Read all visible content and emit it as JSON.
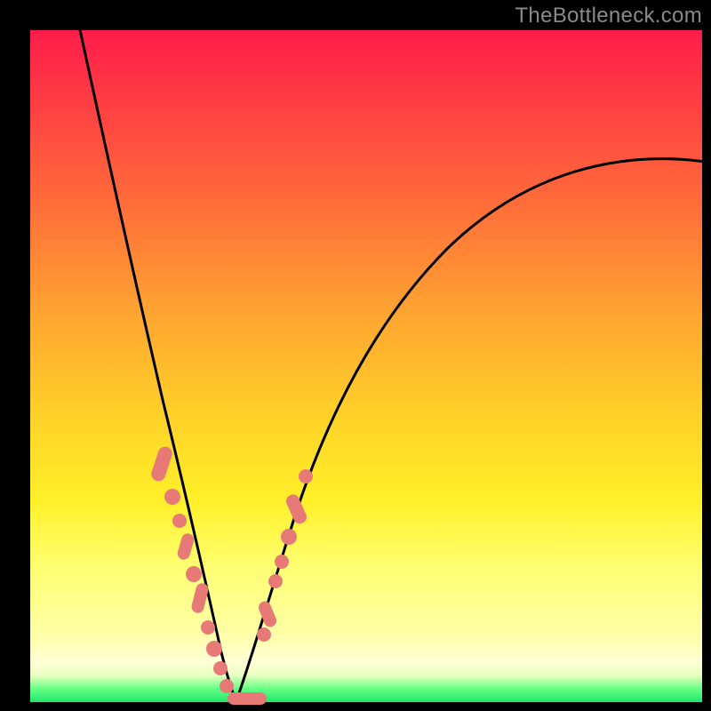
{
  "watermark": "TheBottleneck.com",
  "colors": {
    "gradient_top": "#ff1d4a",
    "gradient_bottom": "#20e86a",
    "curve_stroke": "#000000",
    "marker_fill": "#e77a77",
    "frame": "#000000"
  },
  "chart_data": {
    "type": "line",
    "title": "",
    "xlabel": "",
    "ylabel": "",
    "xlim": [
      0,
      100
    ],
    "ylim": [
      0,
      100
    ],
    "note": "Axes have no tick labels; x/y are percentage-of-plot coordinates. Curve is a V-shaped bottleneck curve with minimum near x≈28, y≈0. Left branch steep, right branch shallower rising to upper-right.",
    "series": [
      {
        "name": "bottleneck-curve-left",
        "x": [
          7,
          9,
          11,
          13,
          15,
          17,
          19,
          21,
          23,
          25,
          26,
          27,
          28,
          29,
          30
        ],
        "y": [
          100,
          92,
          83,
          73,
          63,
          53,
          44,
          35,
          26,
          17,
          12,
          7,
          3,
          1,
          0
        ]
      },
      {
        "name": "bottleneck-curve-right",
        "x": [
          30,
          32,
          34,
          36,
          39,
          43,
          48,
          54,
          62,
          72,
          84,
          100
        ],
        "y": [
          0,
          6,
          13,
          20,
          29,
          39,
          49,
          58,
          66,
          72,
          76,
          80
        ]
      }
    ],
    "markers": [
      {
        "name": "left-cluster",
        "shape": "capsule-and-dots",
        "points": [
          {
            "x": 19.5,
            "y": 36
          },
          {
            "x": 21,
            "y": 31
          },
          {
            "x": 22,
            "y": 27.5
          },
          {
            "x": 23,
            "y": 24
          },
          {
            "x": 23.8,
            "y": 21
          },
          {
            "x": 24.9,
            "y": 16.5
          },
          {
            "x": 26,
            "y": 12
          },
          {
            "x": 27,
            "y": 8
          },
          {
            "x": 27.7,
            "y": 5
          },
          {
            "x": 28.6,
            "y": 2.5
          }
        ]
      },
      {
        "name": "bottom-pill",
        "shape": "pill",
        "points": [
          {
            "x": 29.5,
            "y": 0.7
          },
          {
            "x": 32.5,
            "y": 0.7
          }
        ]
      },
      {
        "name": "right-cluster",
        "shape": "capsule-and-dots",
        "points": [
          {
            "x": 33.5,
            "y": 10
          },
          {
            "x": 34.5,
            "y": 14
          },
          {
            "x": 35.3,
            "y": 17.5
          },
          {
            "x": 36,
            "y": 20
          },
          {
            "x": 37,
            "y": 24
          },
          {
            "x": 38.2,
            "y": 28
          },
          {
            "x": 40,
            "y": 33
          }
        ]
      }
    ]
  }
}
